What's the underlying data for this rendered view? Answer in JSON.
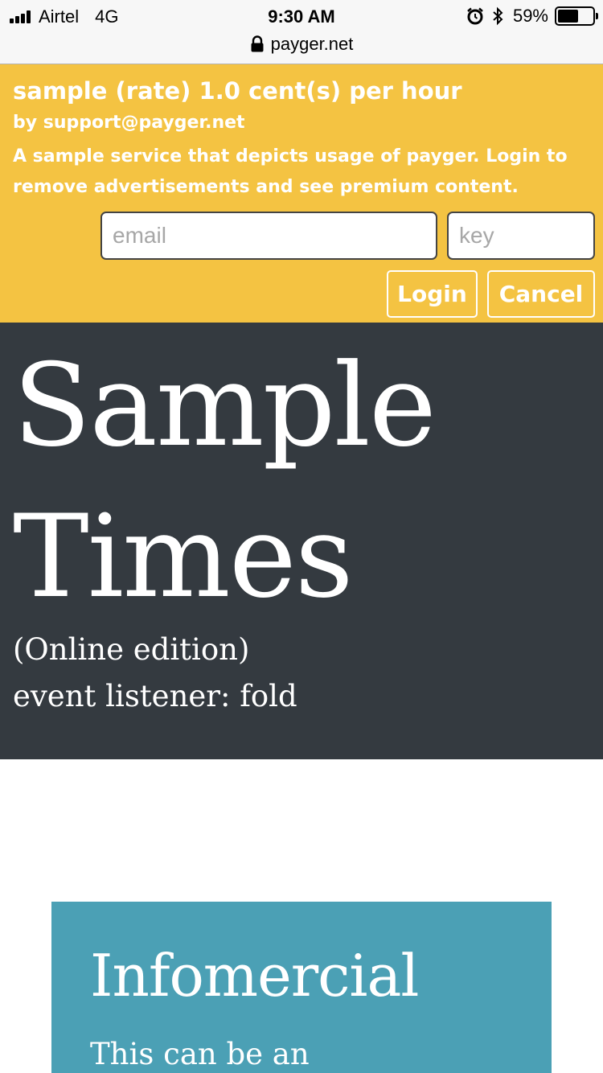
{
  "status_bar": {
    "carrier": "Airtel",
    "network": "4G",
    "time": "9:30 AM",
    "url": "payger.net",
    "battery_percent": "59%",
    "battery_level": 0.59,
    "signal_bars": 4,
    "icons": [
      "signal-icon",
      "lock-icon",
      "alarm-icon",
      "bluetooth-icon",
      "battery-icon"
    ]
  },
  "payger": {
    "title": "sample (rate) 1.0 cent(s) per hour",
    "by": "by support@payger.net",
    "description": "A sample service that depicts usage of payger. Login to remove advertisements and see premium content.",
    "email_placeholder": "email",
    "key_placeholder": "key",
    "login_label": "Login",
    "cancel_label": "Cancel",
    "background_color": "#f4c342"
  },
  "hero": {
    "title": "Sample Times",
    "subtitle": "(Online edition)",
    "event_text": "event listener: fold",
    "background_color": "#343a40"
  },
  "infomercial": {
    "title": "Infomercial",
    "body": "This can be an",
    "background_color": "#4ba0b5"
  }
}
